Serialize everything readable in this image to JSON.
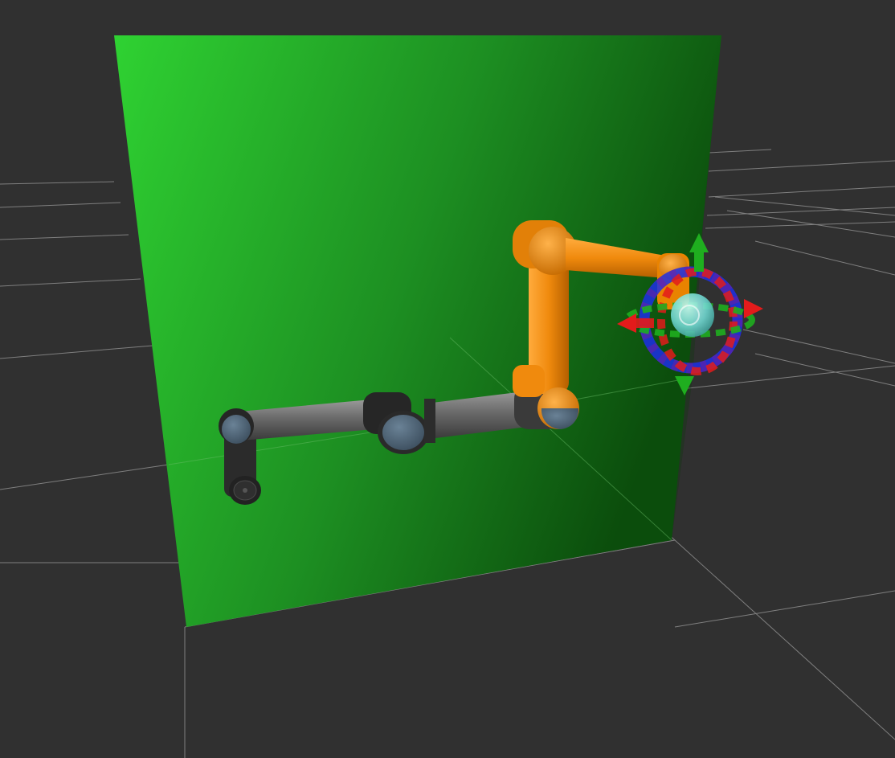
{
  "scene": {
    "background_color": "#303030",
    "grid_color": "#9a9a9a",
    "wall_color_light": "#2fd232",
    "wall_color_dark": "#0b4d0c",
    "goal_robot_color": "#f08a0d",
    "current_robot_color": "#707070",
    "robot_joint_color": "#2a2a2a",
    "robot_cap_color": "#4f6577",
    "marker_colors": {
      "x_axis": "#e31b1b",
      "y_axis": "#1fae1f",
      "z_axis": "#1d2fe6",
      "effector": "#7fe8e0"
    },
    "icons": {
      "interactive_marker": "move-rotate-gizmo-icon",
      "end_effector": "end-effector-sphere-icon"
    }
  }
}
